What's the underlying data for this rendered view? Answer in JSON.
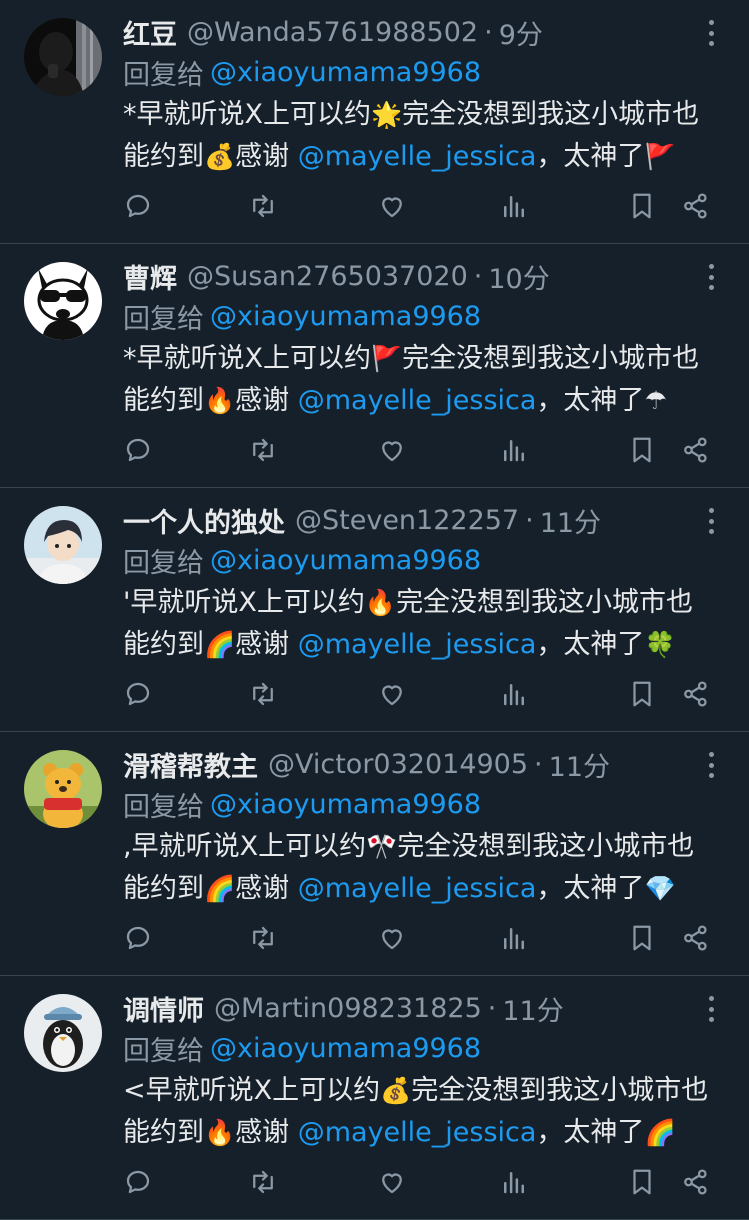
{
  "colors": {
    "background": "#15202b",
    "text": "#e7e9ea",
    "muted": "#8b98a5",
    "link": "#1d9bf0",
    "divider": "#38444d"
  },
  "tweets": [
    {
      "display_name": "红豆",
      "handle": "@Wanda5761988502",
      "time": "9分",
      "reply_prefix": "回复给",
      "reply_to": "@xiaoyumama9968",
      "line1_text": "*早就听说X上可以约",
      "line1_emoji": "🌟",
      "line1_tail": "完全没想到我这小城市也",
      "line2_text": "能约到",
      "line2_emoji": "💰",
      "line2_thanks": "感谢",
      "mention": "@mayelle_jessica",
      "line2_tail": "，太神了",
      "end_emoji": "🚩",
      "avatar_icon": "dark-silhouette-avatar"
    },
    {
      "display_name": "曹辉",
      "handle": "@Susan2765037020",
      "time": "10分",
      "reply_prefix": "回复给",
      "reply_to": "@xiaoyumama9968",
      "line1_text": "*早就听说X上可以约",
      "line1_emoji": "🚩",
      "line1_tail": "完全没想到我这小城市也",
      "line2_text": "能约到",
      "line2_emoji": "🔥",
      "line2_thanks": "感谢",
      "mention": "@mayelle_jessica",
      "line2_tail": "，太神了",
      "end_emoji": "☂",
      "avatar_icon": "cartoon-llama-sunglasses-avatar"
    },
    {
      "display_name": "一个人的独处",
      "handle": "@Steven122257",
      "time": "11分",
      "reply_prefix": "回复给",
      "reply_to": "@xiaoyumama9968",
      "line1_text": "'早就听说X上可以约",
      "line1_emoji": "🔥",
      "line1_tail": "完全没想到我这小城市也",
      "line2_text": "能约到",
      "line2_emoji": "🌈",
      "line2_thanks": "感谢",
      "mention": "@mayelle_jessica",
      "line2_tail": "，太神了",
      "end_emoji": "🍀",
      "avatar_icon": "anime-boy-avatar"
    },
    {
      "display_name": "滑稽帮教主",
      "handle": "@Victor032014905",
      "time": "11分",
      "reply_prefix": "回复给",
      "reply_to": "@xiaoyumama9968",
      "line1_text": ",早就听说X上可以约",
      "line1_emoji": "🎌",
      "line1_tail": "完全没想到我这小城市也",
      "line2_text": "能约到",
      "line2_emoji": "🌈",
      "line2_thanks": "感谢",
      "mention": "@mayelle_jessica",
      "line2_tail": "，太神了",
      "end_emoji": "💎",
      "avatar_icon": "winnie-the-pooh-avatar"
    },
    {
      "display_name": "调情师",
      "handle": "@Martin098231825",
      "time": "11分",
      "reply_prefix": "回复给",
      "reply_to": "@xiaoyumama9968",
      "line1_text": "<早就听说X上可以约",
      "line1_emoji": "💰",
      "line1_tail": "完全没想到我这小城市也",
      "line2_text": "能约到",
      "line2_emoji": "🔥",
      "line2_thanks": "感谢",
      "mention": "@mayelle_jessica",
      "line2_tail": "，太神了",
      "end_emoji": "🌈",
      "avatar_icon": "penguin-with-hat-avatar"
    }
  ]
}
